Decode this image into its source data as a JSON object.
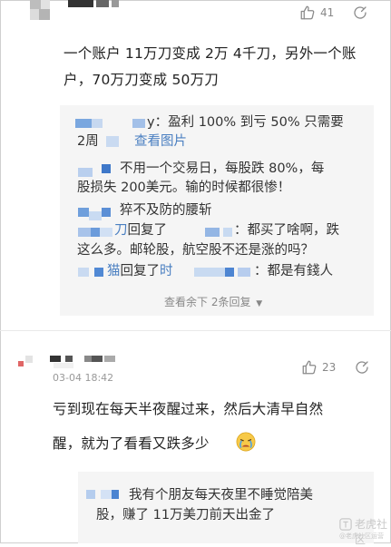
{
  "comment1": {
    "likes": "41",
    "text_line1": "一个账户 11万刀变成 2万 4千刀，另外一个账",
    "text_line2": "户，70万刀变成 50万刀",
    "replies": [
      {
        "name": "",
        "sep": "：",
        "text": "盈利 100% 到亏 50% 只需要",
        "text2": "2周",
        "link": "查看图片"
      },
      {
        "name": "",
        "sep": "",
        "text": "不用一个交易日，每股跌 80%，每",
        "text2": "股损失 200美元。输的时候都很惨！"
      },
      {
        "name": "",
        "sep": "：",
        "text": "猝不及防的腰斩"
      },
      {
        "name": "",
        "mid": "回复了",
        "name2": "",
        "sep": "：",
        "text": "都买了啥啊，跌",
        "text2": "这么多。邮轮股，航空股不还是涨的吗？"
      },
      {
        "name": "",
        "mid": "回复了",
        "name2": "",
        "sep": "：",
        "text": "都是有錢人"
      }
    ],
    "more_replies": "查看余下 2条回复"
  },
  "comment2": {
    "date": "03-04 18:42",
    "likes": "23",
    "text_line1": "亏到现在每天半夜醒过来，然后大清早自然",
    "text_line2": "醒，就为了看看又跌多少",
    "emoji": "crying-face",
    "replies": [
      {
        "name": "",
        "sep": "：",
        "text": "我有个朋友每天夜里不睡觉陪美",
        "text2": "股，赚了 11万美刀前天出金了"
      }
    ]
  },
  "watermark": {
    "title": "老虎社区",
    "subtitle": "@老虎社区运营"
  },
  "colors": {
    "link": "#4a7fc1",
    "reply_bg": "#f5f5f5",
    "muted": "#888888"
  }
}
